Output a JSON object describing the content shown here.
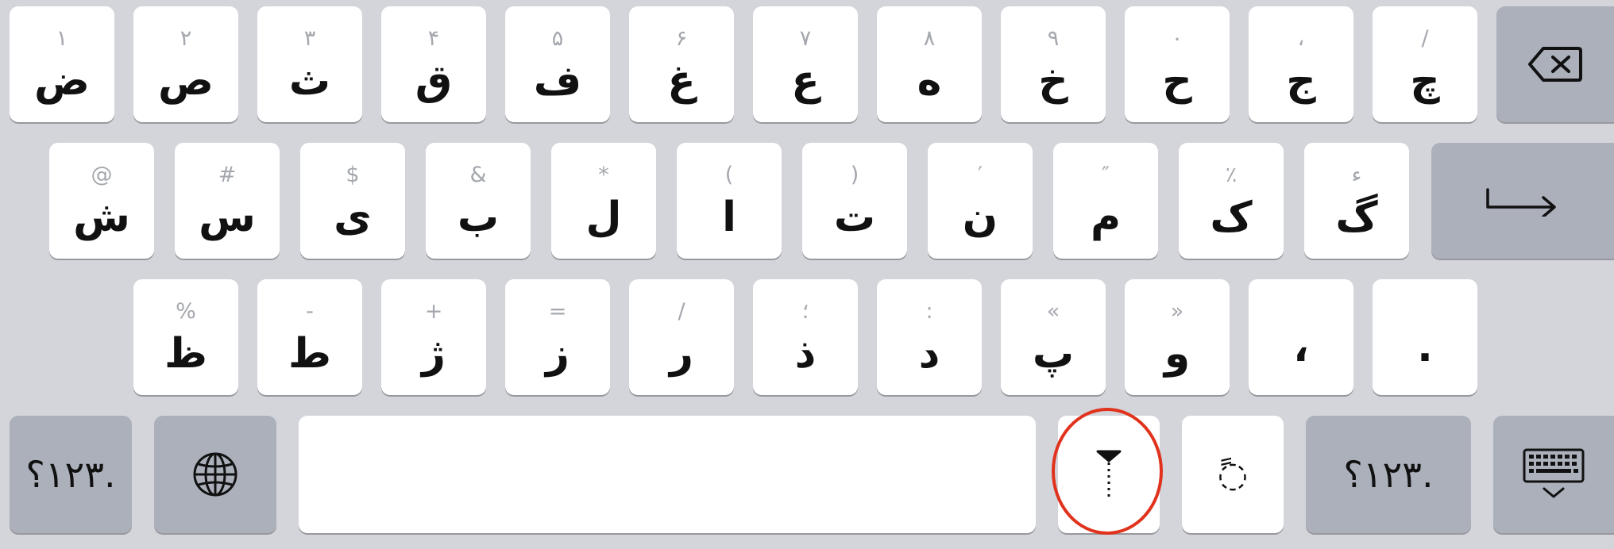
{
  "keyboard": {
    "row1": [
      {
        "hint": "١",
        "main": "ض"
      },
      {
        "hint": "٢",
        "main": "ص"
      },
      {
        "hint": "٣",
        "main": "ث"
      },
      {
        "hint": "۴",
        "main": "ق"
      },
      {
        "hint": "۵",
        "main": "ف"
      },
      {
        "hint": "۶",
        "main": "غ"
      },
      {
        "hint": "٧",
        "main": "ع"
      },
      {
        "hint": "٨",
        "main": "ه"
      },
      {
        "hint": "٩",
        "main": "خ"
      },
      {
        "hint": "٠",
        "main": "ح"
      },
      {
        "hint": "،",
        "main": "ج"
      },
      {
        "hint": "/",
        "main": "چ"
      }
    ],
    "row2": [
      {
        "hint": "@",
        "main": "ش"
      },
      {
        "hint": "#",
        "main": "س"
      },
      {
        "hint": "$",
        "main": "ی"
      },
      {
        "hint": "&",
        "main": "ب"
      },
      {
        "hint": "*",
        "main": "ل"
      },
      {
        "hint": "(",
        "main": "ا"
      },
      {
        "hint": ")",
        "main": "ت"
      },
      {
        "hint": "′",
        "main": "ن"
      },
      {
        "hint": "″",
        "main": "م"
      },
      {
        "hint": "٪",
        "main": "ک"
      },
      {
        "hint": "ء",
        "main": "گ"
      }
    ],
    "row3": [
      {
        "hint": "%",
        "main": "ظ"
      },
      {
        "hint": "-",
        "main": "ط"
      },
      {
        "hint": "+",
        "main": "ژ"
      },
      {
        "hint": "=",
        "main": "ز"
      },
      {
        "hint": "/",
        "main": "ر"
      },
      {
        "hint": "؛",
        "main": "ذ"
      },
      {
        "hint": ":",
        "main": "د"
      },
      {
        "hint": "«",
        "main": "پ"
      },
      {
        "hint": "»",
        "main": "و"
      },
      {
        "hint": "",
        "main": "،"
      },
      {
        "hint": "",
        "main": "."
      }
    ],
    "bottom": {
      "numbers_left_label": "١٢٣؟.",
      "numbers_right_label": "١٢٣؟.",
      "tanvin_label": "◌ً"
    },
    "icons": {
      "delete": "delete-icon",
      "return": "return-icon",
      "globe": "globe-icon",
      "zwnj": "zwnj-icon",
      "dismiss": "keyboard-dismiss-icon"
    },
    "colors": {
      "background": "#d3d5db",
      "letter_key": "#ffffff",
      "function_key": "#abb0bb",
      "highlight": "#e0321c"
    }
  }
}
